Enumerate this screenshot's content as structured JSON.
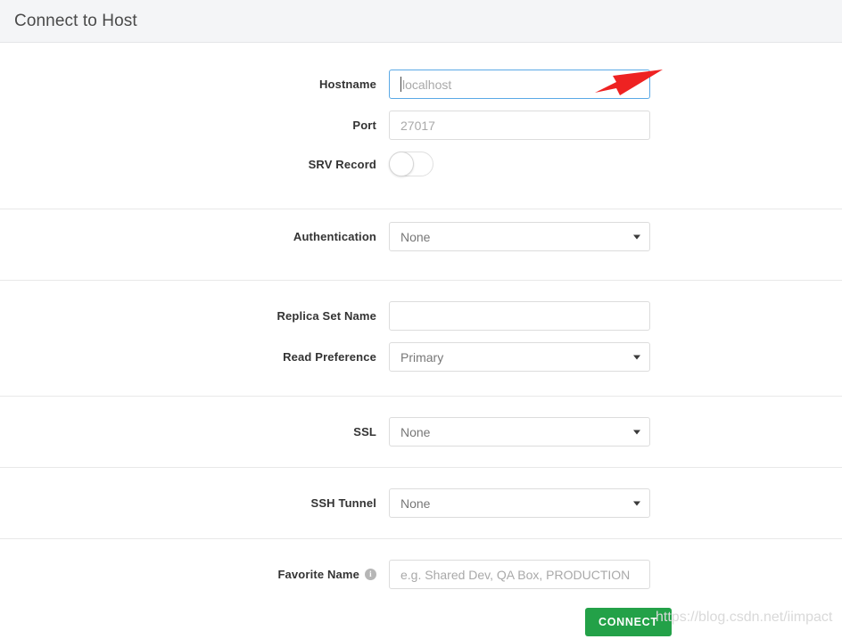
{
  "window": {
    "title": "Connect to Host"
  },
  "form": {
    "sections": [
      {
        "name": "host",
        "rows": [
          {
            "label": "Hostname",
            "type": "text-focused",
            "value": "",
            "placeholder": "localhost"
          },
          {
            "label": "Port",
            "type": "text",
            "value": "",
            "placeholder": "27017"
          },
          {
            "label": "SRV Record",
            "type": "toggle",
            "state": "off"
          }
        ]
      },
      {
        "name": "authentication",
        "rows": [
          {
            "label": "Authentication",
            "type": "select",
            "value": "None"
          }
        ]
      },
      {
        "name": "replica",
        "rows": [
          {
            "label": "Replica Set Name",
            "type": "text",
            "value": "",
            "placeholder": ""
          },
          {
            "label": "Read Preference",
            "type": "select",
            "value": "Primary"
          }
        ]
      },
      {
        "name": "ssl",
        "rows": [
          {
            "label": "SSL",
            "type": "select",
            "value": "None"
          }
        ]
      },
      {
        "name": "ssh",
        "rows": [
          {
            "label": "SSH Tunnel",
            "type": "select",
            "value": "None"
          }
        ]
      },
      {
        "name": "favorite",
        "rows": [
          {
            "label": "Favorite Name",
            "type": "text",
            "value": "",
            "placeholder": "e.g. Shared Dev, QA Box, PRODUCTION",
            "info_icon": "i"
          }
        ]
      }
    ]
  },
  "footer": {
    "connect_label": "CONNECT"
  },
  "watermark": {
    "text": "https://blog.csdn.net/iimpact"
  },
  "annotation": {
    "arrow_color": "#ee2222",
    "points_to": "hostname-input"
  },
  "colors": {
    "accent_green": "#23a148",
    "focus_blue": "#5aa9e6",
    "header_bg": "#f4f5f7",
    "divider": "#e8e8e8"
  }
}
